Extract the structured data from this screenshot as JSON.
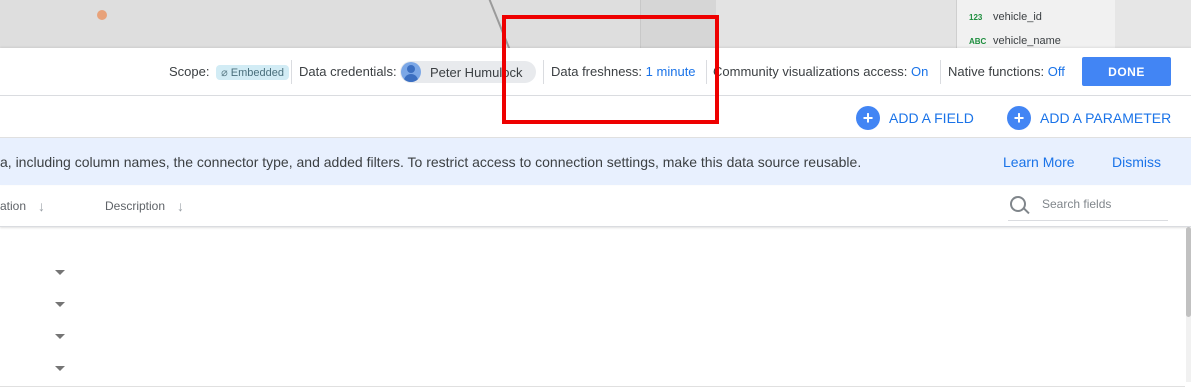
{
  "canvas": {
    "field_list": [
      {
        "type": "123",
        "name": "vehicle_id"
      },
      {
        "type": "ABC",
        "name": "vehicle_name"
      }
    ]
  },
  "toolbar": {
    "scope_label": "Scope:",
    "scope_value": "Embedded",
    "credentials_label": "Data credentials:",
    "credentials_user": "Peter Humulock",
    "freshness_label": "Data freshness:",
    "freshness_value": "1 minute",
    "community_label": "Community visualizations access:",
    "community_value": "On",
    "native_label": "Native functions:",
    "native_value": "Off",
    "done_label": "DONE"
  },
  "actions": {
    "add_field_label": "ADD A FIELD",
    "add_parameter_label": "ADD A PARAMETER"
  },
  "banner": {
    "text": "a, including column names, the connector type, and added filters. To restrict access to connection settings, make this data source reusable.",
    "learn_more": "Learn More",
    "dismiss": "Dismiss"
  },
  "table": {
    "columns": [
      "ation",
      "Description"
    ],
    "search_placeholder": "Search fields",
    "row_count": 4
  },
  "colors": {
    "accent": "#1a73e8",
    "done_button": "#4285f4",
    "banner_bg": "#e8f0fe",
    "highlight": "#ee0000"
  }
}
